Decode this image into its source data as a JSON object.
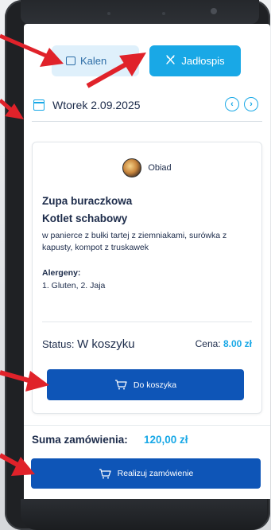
{
  "tabs": {
    "calendar_label": "Kalen",
    "menu_label": "Jadłospis"
  },
  "date": {
    "label": "Wtorek 2.09.2025",
    "prev": "‹",
    "next": "›"
  },
  "card": {
    "meal_type": "Obiad",
    "dish_1": "Zupa buraczkowa",
    "dish_2": "Kotlet schabowy",
    "description": "w panierce z bułki tartej z ziemniakami, surówka z kapusty, kompot z truskawek",
    "allergens_title": "Alergeny:",
    "allergens_value": "1. Gluten, 2. Jaja",
    "status_prefix": "Status: ",
    "status_value": "W koszyku",
    "price_prefix": "Cena: ",
    "price_value": "8.00 zł",
    "cart_button": "Do koszyka"
  },
  "summary": {
    "label": "Suma zamówienia:",
    "value": "120,00 zł",
    "order_button": "Realizuj zamówienie"
  },
  "colors": {
    "accent": "#19a8e6",
    "primary_button": "#0e55b7",
    "arrow": "#e0222a"
  }
}
